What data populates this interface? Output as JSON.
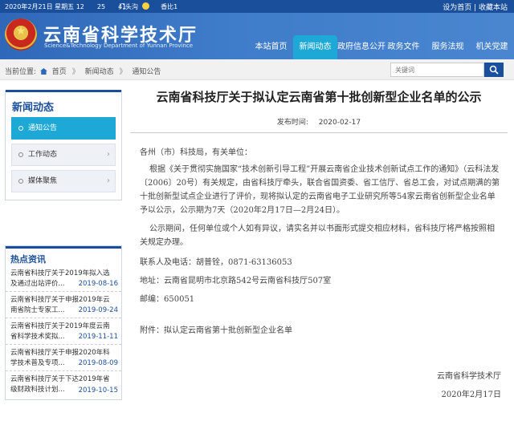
{
  "topbar": {
    "date": "2020年2月21日 星期五 12　　25　　41",
    "weather_city": "门头沟",
    "weather_extra": "香比1",
    "links": "设为首页 | 收藏本站"
  },
  "header": {
    "site_title": "云南省科学技术厅",
    "site_subtitle": "Science&Technology Department of Yunnan Province",
    "nav": [
      {
        "label": "本站首页"
      },
      {
        "label": "新闻动态"
      },
      {
        "label": "政府信息公开"
      },
      {
        "label": "政务文件"
      },
      {
        "label": "服务法规"
      },
      {
        "label": "机关党建"
      }
    ]
  },
  "breadcrumb": {
    "label": "当前位置:",
    "items": [
      "首页",
      "新闻动态",
      "通知公告"
    ],
    "separator": "》"
  },
  "search": {
    "placeholder": "关键词"
  },
  "sidebar": {
    "title": "新闻动态",
    "items": [
      {
        "label": "通知公告"
      },
      {
        "label": "工作动态"
      },
      {
        "label": "媒体聚焦"
      }
    ]
  },
  "hot": {
    "title": "热点资讯",
    "items": [
      {
        "line1": "云南省科技厅关于2019年拟入选",
        "line2": "及通过出站评价...",
        "date": "2019-08-16"
      },
      {
        "line1": "云南省科技厅关于申报2019年云",
        "line2": "南省院士专家工...",
        "date": "2019-09-24"
      },
      {
        "line1": "云南省科技厅关于2019年度云南",
        "line2": "省科学技术奖拟...",
        "date": "2019-11-11"
      },
      {
        "line1": "云南省科技厅关于申报2020年科",
        "line2": "学技术普及专项...",
        "date": "2019-08-09"
      },
      {
        "line1": "云南省科技厅关于下达2019年省",
        "line2": "级财政科技计划...",
        "date": "2019-10-15"
      }
    ]
  },
  "article": {
    "title": "云南省科技厅关于拟认定云南省第十批创新型企业名单的公示",
    "date_label": "发布时间:",
    "date": "2020-02-17",
    "greeting": "各州（市）科技局，有关单位：",
    "para1": "根据《关于贯彻实施国家“技术创新引导工程”开展云南省企业技术创新试点工作的通知》（云科法发〔2006〕20号）有关规定，由省科技厅牵头，联合省国资委、省工信厅、省总工会，对试点期满的第十批创新型试点企业进行了评价，现将拟认定的云南省电子工业研究所等54家云南省创新型企业名单予以公示，公示期为7天（2020年2月17日—2月24日）。",
    "para2": "公示期间，任何单位或个人如有异议，请实名并以书面形式提交相应材料，省科技厅将严格按照相关规定办理。",
    "contact": "联系人及电话：胡普铨，0871-63136053",
    "address": "地址：云南省昆明市北京路542号云南省科技厅507室",
    "postcode": "邮编：650051",
    "attachment": "附件：拟认定云南省第十批创新型企业名单",
    "signature": "云南省科学技术厅",
    "sign_date": "2020年2月17日"
  }
}
